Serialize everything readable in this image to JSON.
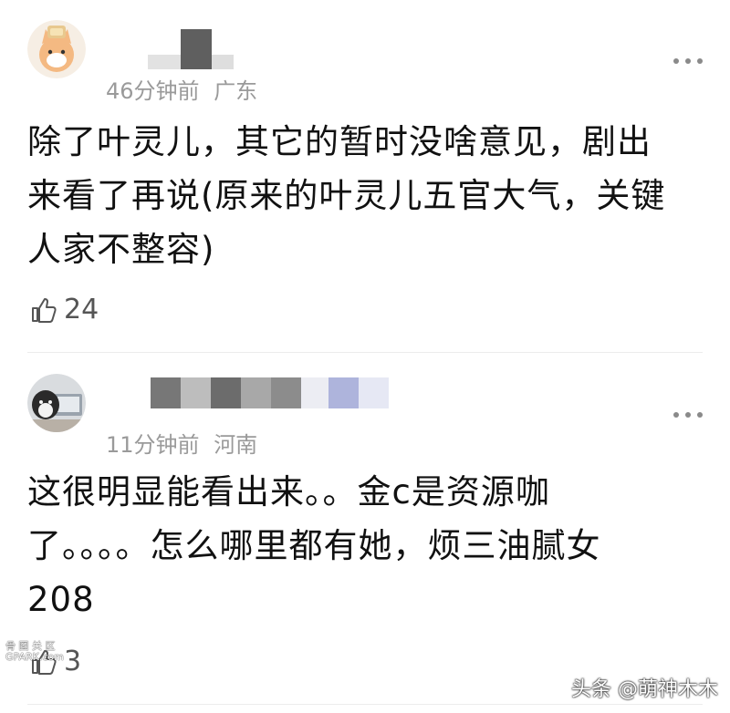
{
  "comments": [
    {
      "time": "46分钟前",
      "location": "广东",
      "lines": [
        "除了叶灵儿，其它的暂时没啥意见，剧出",
        "来看了再说(原来的叶灵儿五官大气，关键",
        "人家不整容)"
      ],
      "likes": "24"
    },
    {
      "time": "11分钟前",
      "location": "河南",
      "lines": [
        "这很明显能看出来。。金c是资源咖",
        "了。。。。怎么哪里都有她，烦三油腻女",
        "208"
      ],
      "likes": "3"
    }
  ],
  "watermark": "头条 @萌神木木",
  "site_mark": {
    "line1": "骨 图 关 区",
    "line2": "GPARK.com"
  }
}
